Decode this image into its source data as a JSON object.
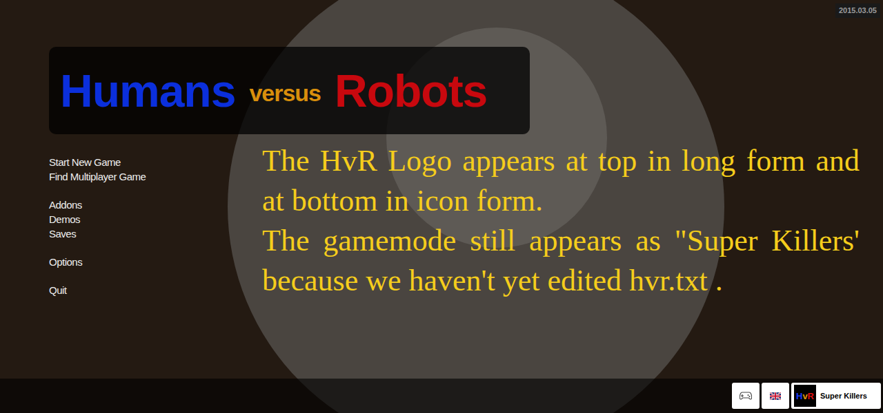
{
  "version": "2015.03.05",
  "logo": [
    {
      "text": "Humans",
      "color": "#0b2fdc"
    },
    {
      "text": "versus",
      "color": "#d98f0c"
    },
    {
      "text": "Robots",
      "color": "#c8080e"
    }
  ],
  "menu": [
    [
      "Start New Game",
      "Find Multiplayer Game"
    ],
    [
      "Addons",
      "Demos",
      "Saves"
    ],
    [
      "Options"
    ],
    [
      "Quit"
    ]
  ],
  "caption": [
    "The HvR Logo appears at top in long form and at bottom in icon form.",
    "The gamemode still appears as \"Super Killers' because we haven't yet edited hvr.txt ."
  ],
  "bottom_bar": {
    "gamemode": {
      "icon": [
        {
          "text": "H",
          "color": "#1a3cff"
        },
        {
          "text": "v",
          "color": "#e0960f"
        },
        {
          "text": "R",
          "color": "#e01010"
        }
      ],
      "label": "Super Killers"
    }
  }
}
